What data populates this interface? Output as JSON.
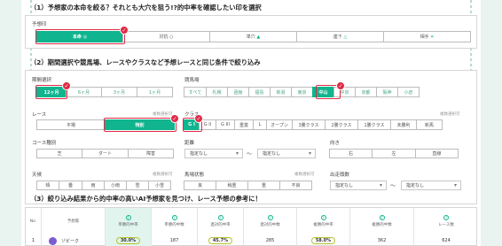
{
  "section1": {
    "title": "（1）予想家の本命を絞る？それとも大穴を狙う!?的中率を確認したい印を選択",
    "label": "予想印",
    "marks": [
      {
        "label": "本命",
        "icon": "◎",
        "selected": true
      },
      {
        "label": "対抗",
        "icon": "○",
        "selected": false
      },
      {
        "label": "単穴",
        "icon": "▲",
        "selected": false
      },
      {
        "label": "連下",
        "icon": "△",
        "selected": false
      },
      {
        "label": "相手",
        "icon": "✕",
        "selected": false
      }
    ]
  },
  "section2": {
    "title": "（2）期間選択や競馬場、レースやクラスなど予想レースと同じ条件で絞り込み",
    "period": {
      "label": "期間選択",
      "options": [
        "12ヶ月",
        "6ヶ月",
        "3ヶ月",
        "1ヶ月"
      ]
    },
    "course": {
      "label": "競馬場",
      "options": [
        "すべて",
        "札幌",
        "函館",
        "福島",
        "新潟",
        "東京",
        "中山",
        "中京",
        "京都",
        "阪神",
        "小倉"
      ]
    },
    "race": {
      "label": "レース",
      "note": "複数選択可",
      "options": [
        "平場",
        "特別"
      ]
    },
    "class": {
      "label": "クラス",
      "note": "複数選択可",
      "options": [
        "G I",
        "G II",
        "G III",
        "重賞",
        "L",
        "オープン",
        "3勝クラス",
        "2勝クラス",
        "1勝クラス",
        "未勝利",
        "新馬"
      ]
    },
    "surface": {
      "label": "コース種別",
      "options": [
        "芝",
        "ダート",
        "障害"
      ]
    },
    "distance": {
      "label": "距離",
      "from": "指定なし",
      "to": "指定なし",
      "tilde": "〜"
    },
    "direction": {
      "label": "向き",
      "options": [
        "右",
        "左",
        "直線"
      ]
    },
    "weather": {
      "label": "天候",
      "note": "複数選択可",
      "options": [
        "晴",
        "曇",
        "雨",
        "小雨",
        "雪",
        "小雪"
      ]
    },
    "track": {
      "label": "馬場状態",
      "note": "複数選択可",
      "options": [
        "良",
        "稍重",
        "重",
        "不良"
      ]
    },
    "runners": {
      "label": "出走頭数",
      "from": "指定なし",
      "to": "指定なし",
      "tilde": "〜"
    }
  },
  "section3": {
    "title": "（3）絞り込み結果から的中率の高いAI予想家を見つけ、レース予想の参考に！",
    "columns": [
      "No.",
      "予想家",
      "単勝的中率",
      "単勝的中数",
      "連対的中率",
      "連対的中数",
      "複勝的中率",
      "複勝的中数",
      "レース数"
    ],
    "row": {
      "no": "1",
      "name": "ゾビーク",
      "win_rate": "30.0%",
      "win_count": "187",
      "quinella_rate": "45.7%",
      "quinella_count": "285",
      "place_rate": "58.0%",
      "place_count": "362",
      "races": "624"
    }
  },
  "colors": {
    "accent": "#10b48e",
    "alert": "#e02a45",
    "text_accent": "#48a48b"
  }
}
